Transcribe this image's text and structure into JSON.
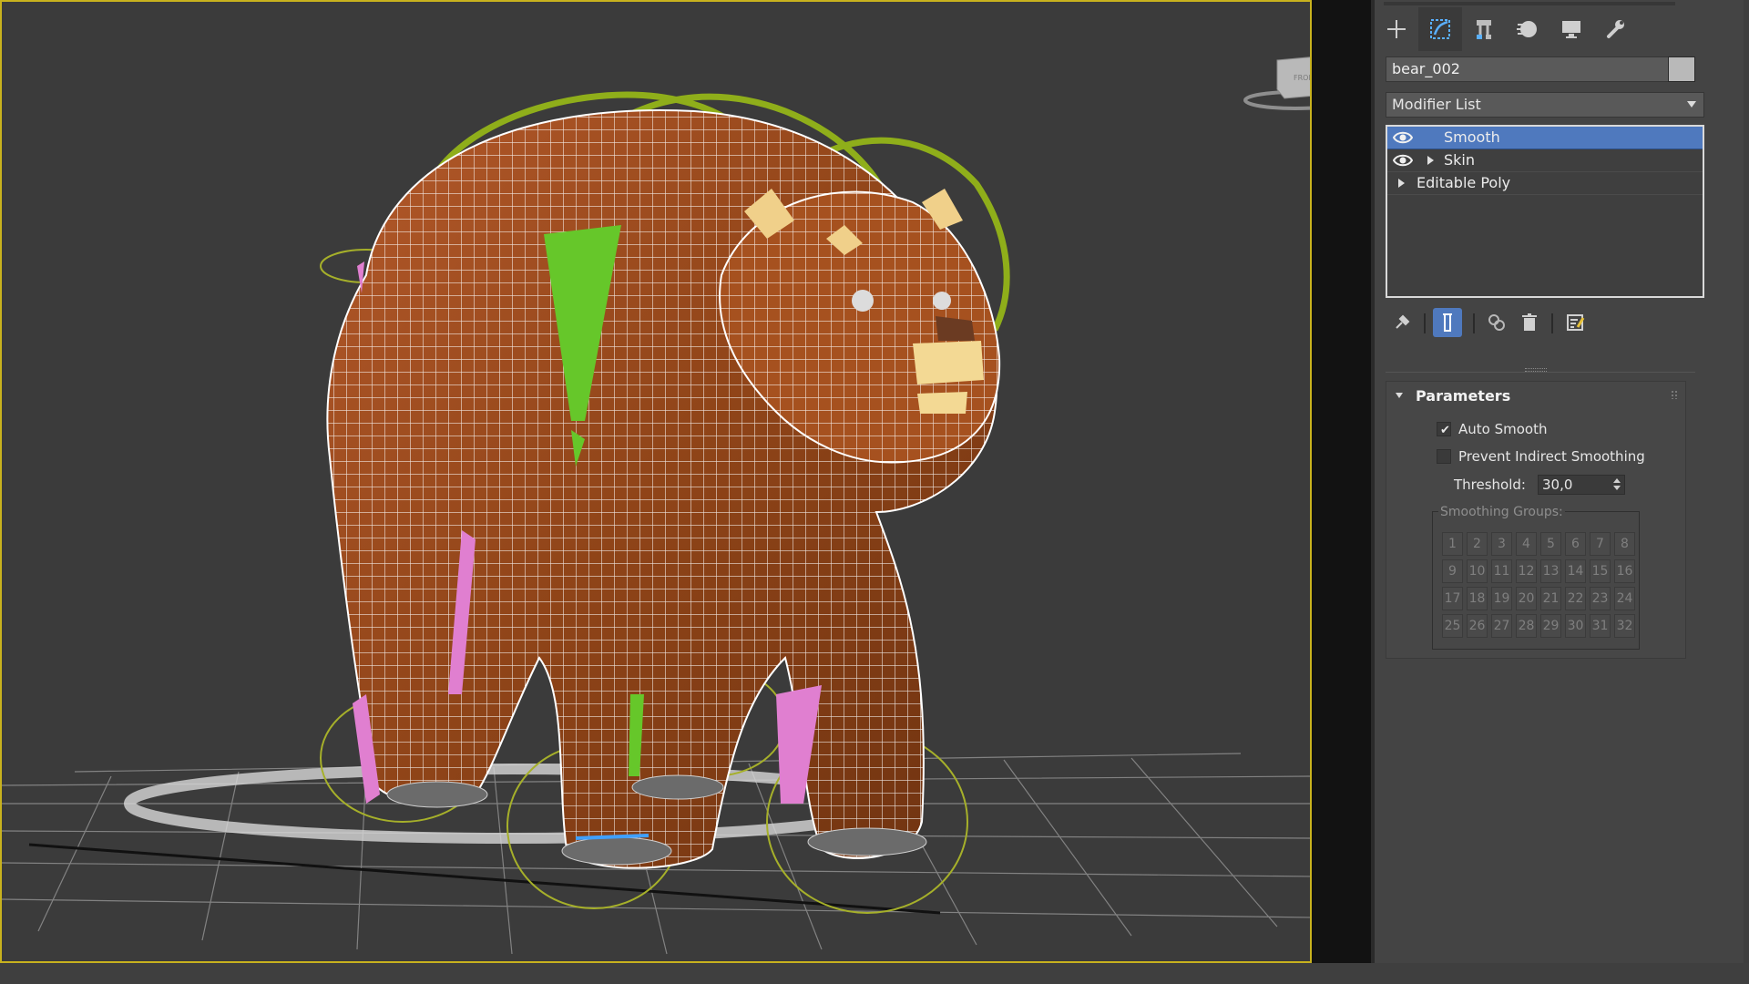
{
  "command_panel": {
    "tabs": [
      {
        "icon": "create-plus-icon"
      },
      {
        "icon": "modify-bend-icon",
        "active": true
      },
      {
        "icon": "hierarchy-icon"
      },
      {
        "icon": "motion-sphere-icon"
      },
      {
        "icon": "display-monitor-icon"
      },
      {
        "icon": "utilities-wrench-icon"
      }
    ],
    "object_name": "bear_002",
    "object_color": "#b9b9b9",
    "modifier_list_label": "Modifier List",
    "stack": [
      {
        "label": "Smooth",
        "visible_eye": true,
        "expand_arrow": false,
        "selected": true
      },
      {
        "label": "Skin",
        "visible_eye": true,
        "expand_arrow": true,
        "selected": false
      },
      {
        "label": "Editable Poly",
        "visible_eye": false,
        "expand_arrow": true,
        "selected": false
      }
    ],
    "stack_tools": [
      {
        "icon": "pin-stack-icon"
      },
      {
        "icon": "show-end-result-icon",
        "active": true
      },
      {
        "icon": "make-unique-icon"
      },
      {
        "icon": "remove-modifier-icon"
      },
      {
        "icon": "configure-modifier-sets-icon"
      }
    ]
  },
  "parameters": {
    "title": "Parameters",
    "auto_smooth": {
      "label": "Auto Smooth",
      "checked": true
    },
    "prevent_indirect": {
      "label": "Prevent Indirect Smoothing",
      "checked": false
    },
    "threshold": {
      "label": "Threshold:",
      "value": "30,0"
    },
    "smoothing_groups": {
      "title": "Smoothing Groups:",
      "cells": [
        "1",
        "2",
        "3",
        "4",
        "5",
        "6",
        "7",
        "8",
        "9",
        "10",
        "11",
        "12",
        "13",
        "14",
        "15",
        "16",
        "17",
        "18",
        "19",
        "20",
        "21",
        "22",
        "23",
        "24",
        "25",
        "26",
        "27",
        "28",
        "29",
        "30",
        "31",
        "32"
      ]
    }
  },
  "viewport": {
    "viewcube_label": "FRONT",
    "border_color": "#c8b21e",
    "background": "#3b3b3b"
  },
  "colors": {
    "selection_blue": "#4f79be",
    "panel_bg": "#444444",
    "bone_green": "#66c72a",
    "bone_pink": "#e07fd0",
    "fur_brown": "#9a4a1c"
  }
}
